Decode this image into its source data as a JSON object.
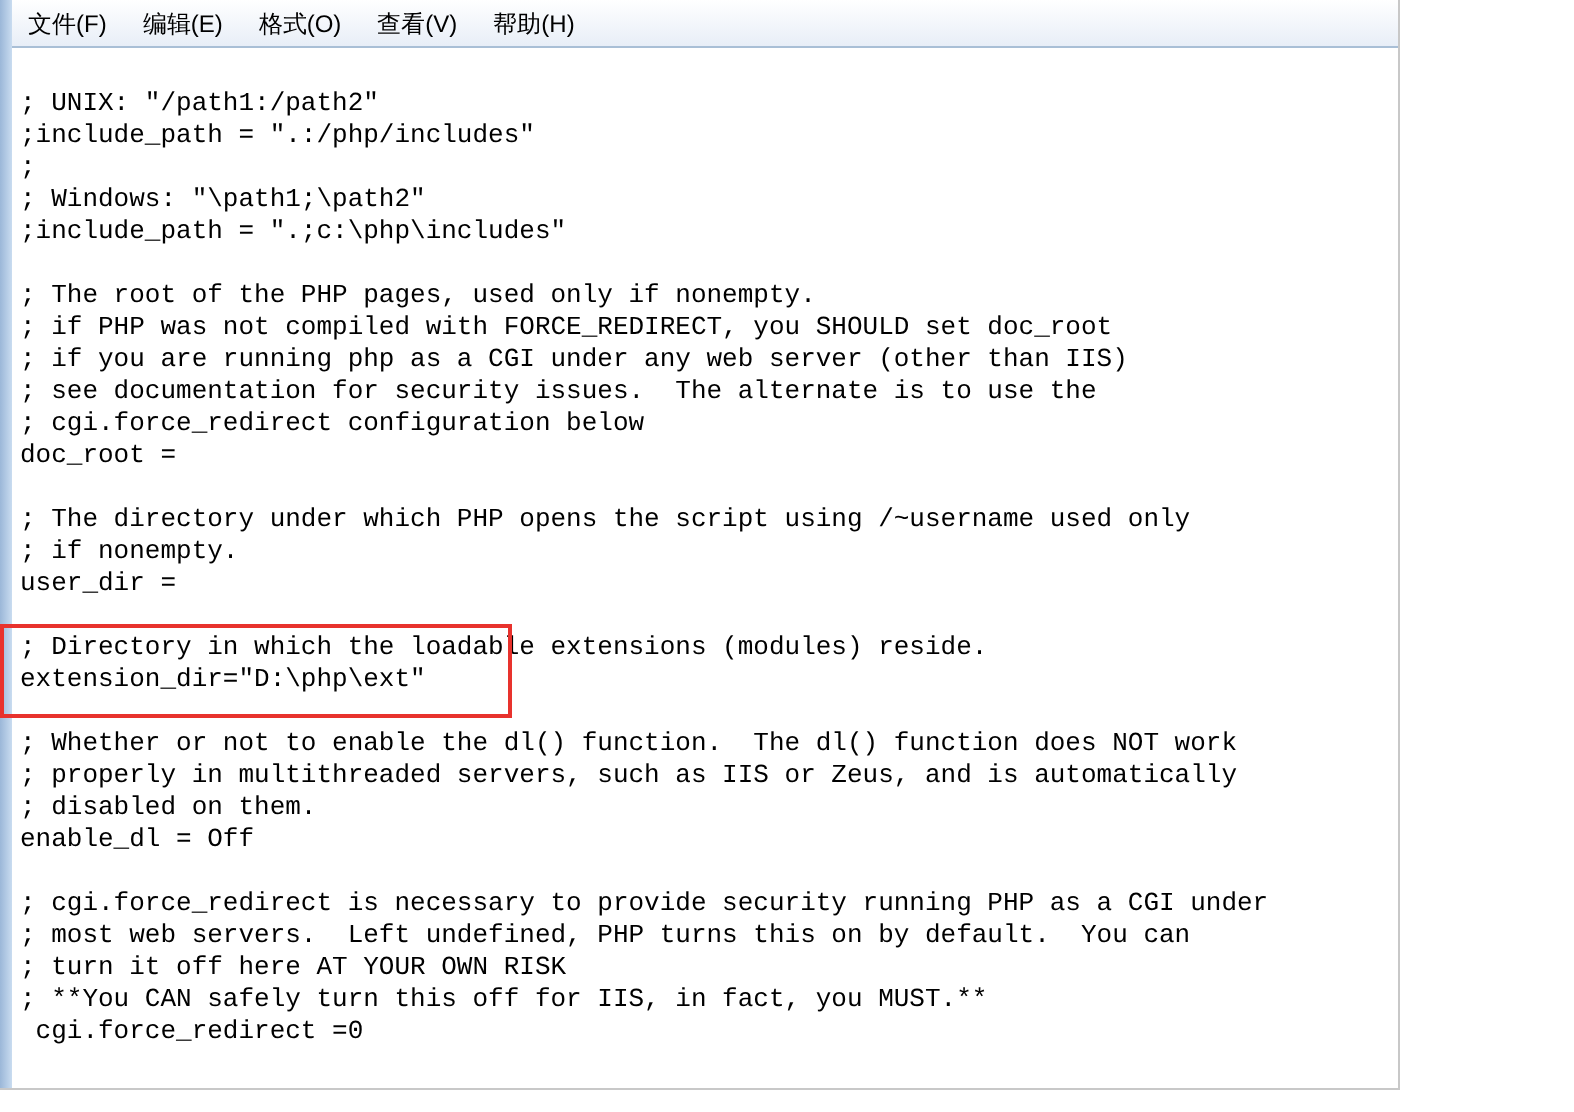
{
  "menu": [
    "文件(F)",
    "编辑(E)",
    "格式(O)",
    "查看(V)",
    "帮助(H)"
  ],
  "lines": [
    {
      "kind": "text",
      "text": "; UNIX: \"/path1:/path2\""
    },
    {
      "kind": "text",
      "text": ";include_path = \".:/php/includes\""
    },
    {
      "kind": "text",
      "text": ";"
    },
    {
      "kind": "text",
      "text": "; Windows: \"\\path1;\\path2\""
    },
    {
      "kind": "text",
      "text": ";include_path = \".;c:\\php\\includes\""
    },
    {
      "kind": "blank"
    },
    {
      "kind": "text",
      "text": "; The root of the PHP pages, used only if nonempty."
    },
    {
      "kind": "text",
      "text": "; if PHP was not compiled with FORCE_REDIRECT, you SHOULD set doc_root"
    },
    {
      "kind": "text",
      "text": "; if you are running php as a CGI under any web server (other than IIS)"
    },
    {
      "kind": "text",
      "text": "; see documentation for security issues.  The alternate is to use the"
    },
    {
      "kind": "text",
      "text": "; cgi.force_redirect configuration below"
    },
    {
      "kind": "text",
      "text": "doc_root ="
    },
    {
      "kind": "blank"
    },
    {
      "kind": "text",
      "text": "; The directory under which PHP opens the script using /~username used only"
    },
    {
      "kind": "text",
      "text": "; if nonempty."
    },
    {
      "kind": "text",
      "text": "user_dir ="
    },
    {
      "kind": "blank"
    },
    {
      "kind": "text",
      "text": "; Directory in which the loadable extensions (modules) reside."
    },
    {
      "kind": "text",
      "text": "extension_dir=\"D:\\php\\ext\""
    },
    {
      "kind": "blank"
    },
    {
      "kind": "text",
      "text": "; Whether or not to enable the dl() function.  The dl() function does NOT work"
    },
    {
      "kind": "text",
      "text": "; properly in multithreaded servers, such as IIS or Zeus, and is automatically"
    },
    {
      "kind": "text",
      "text": "; disabled on them."
    },
    {
      "kind": "text",
      "text": "enable_dl = Off"
    },
    {
      "kind": "blank"
    },
    {
      "kind": "text",
      "text": "; cgi.force_redirect is necessary to provide security running PHP as a CGI under"
    },
    {
      "kind": "text",
      "text": "; most web servers.  Left undefined, PHP turns this on by default.  You can"
    },
    {
      "kind": "text",
      "text": "; turn it off here AT YOUR OWN RISK"
    },
    {
      "kind": "text",
      "text": "; **You CAN safely turn this off for IIS, in fact, you MUST.**"
    },
    {
      "kind": "text",
      "text": " cgi.force_redirect =0"
    }
  ]
}
